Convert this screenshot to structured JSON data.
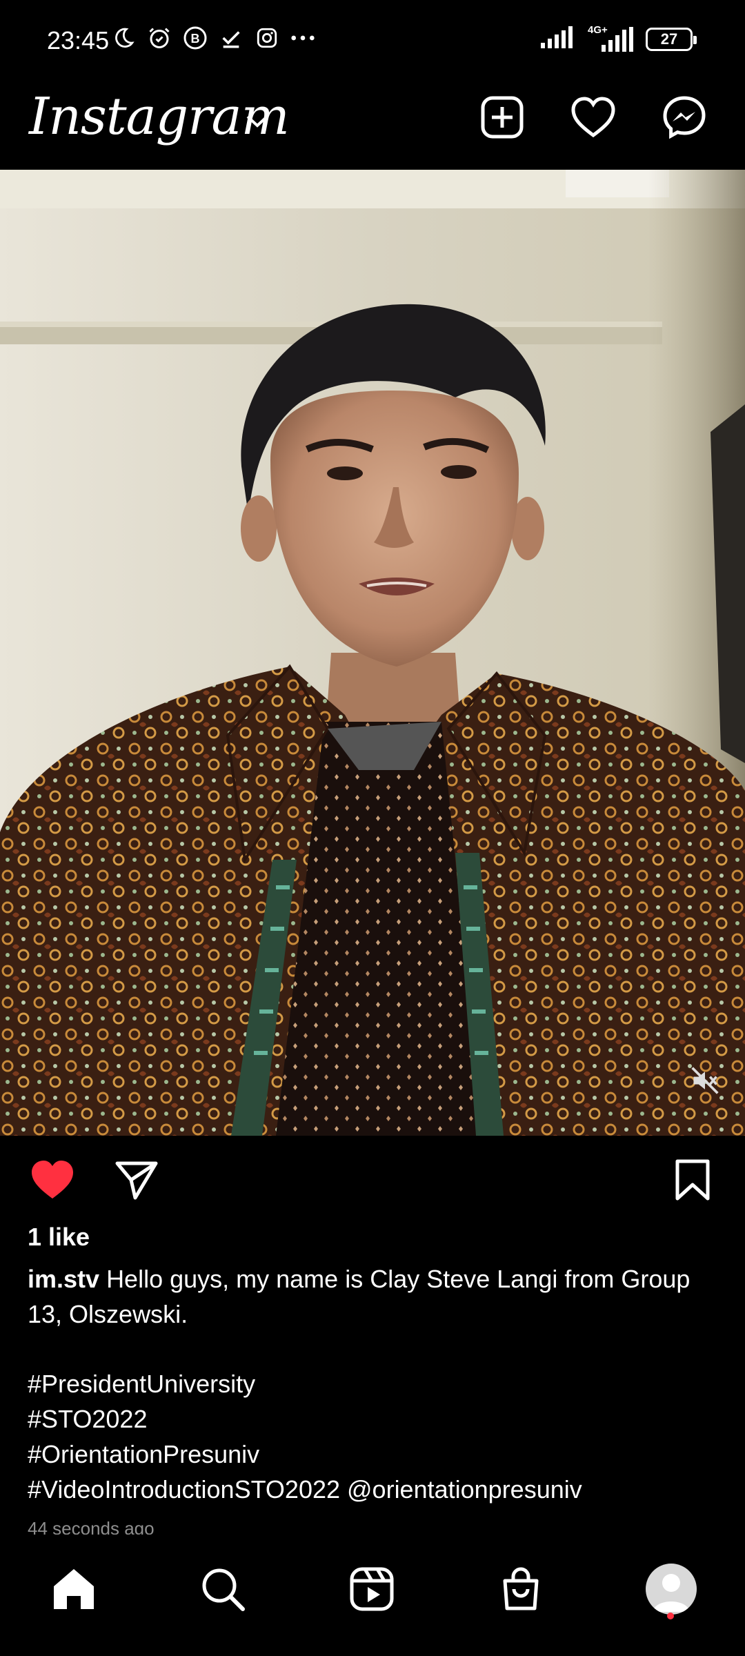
{
  "status_bar": {
    "time": "23:45",
    "left_icons": [
      "moon-icon",
      "alarm-icon",
      "b-app-icon",
      "check-icon",
      "instagram-icon",
      "more-dots-icon"
    ],
    "network_label": "4G+",
    "battery": "27"
  },
  "header": {
    "brand": "Instagram",
    "icons": [
      "add-post-icon",
      "heart-icon",
      "messenger-icon"
    ]
  },
  "post": {
    "muted": true,
    "liked": true,
    "like_color": "#ff3040",
    "likes_text": "1 like",
    "username": "im.stv",
    "caption_text": "Hello guys, my name is Clay Steve Langi from Group 13, Olszewski.",
    "hashtags": [
      "#PresidentUniversity",
      "#STO2022",
      "#OrientationPresuniv",
      "#VideoIntroductionSTO2022  @orientationpresuniv"
    ],
    "timestamp": "44 seconds ago"
  },
  "bottom_nav": {
    "items": [
      "home-icon",
      "search-icon",
      "reels-icon",
      "shop-icon",
      "profile-avatar"
    ],
    "active": "home-icon",
    "notification_dot_color": "#ff3040"
  }
}
